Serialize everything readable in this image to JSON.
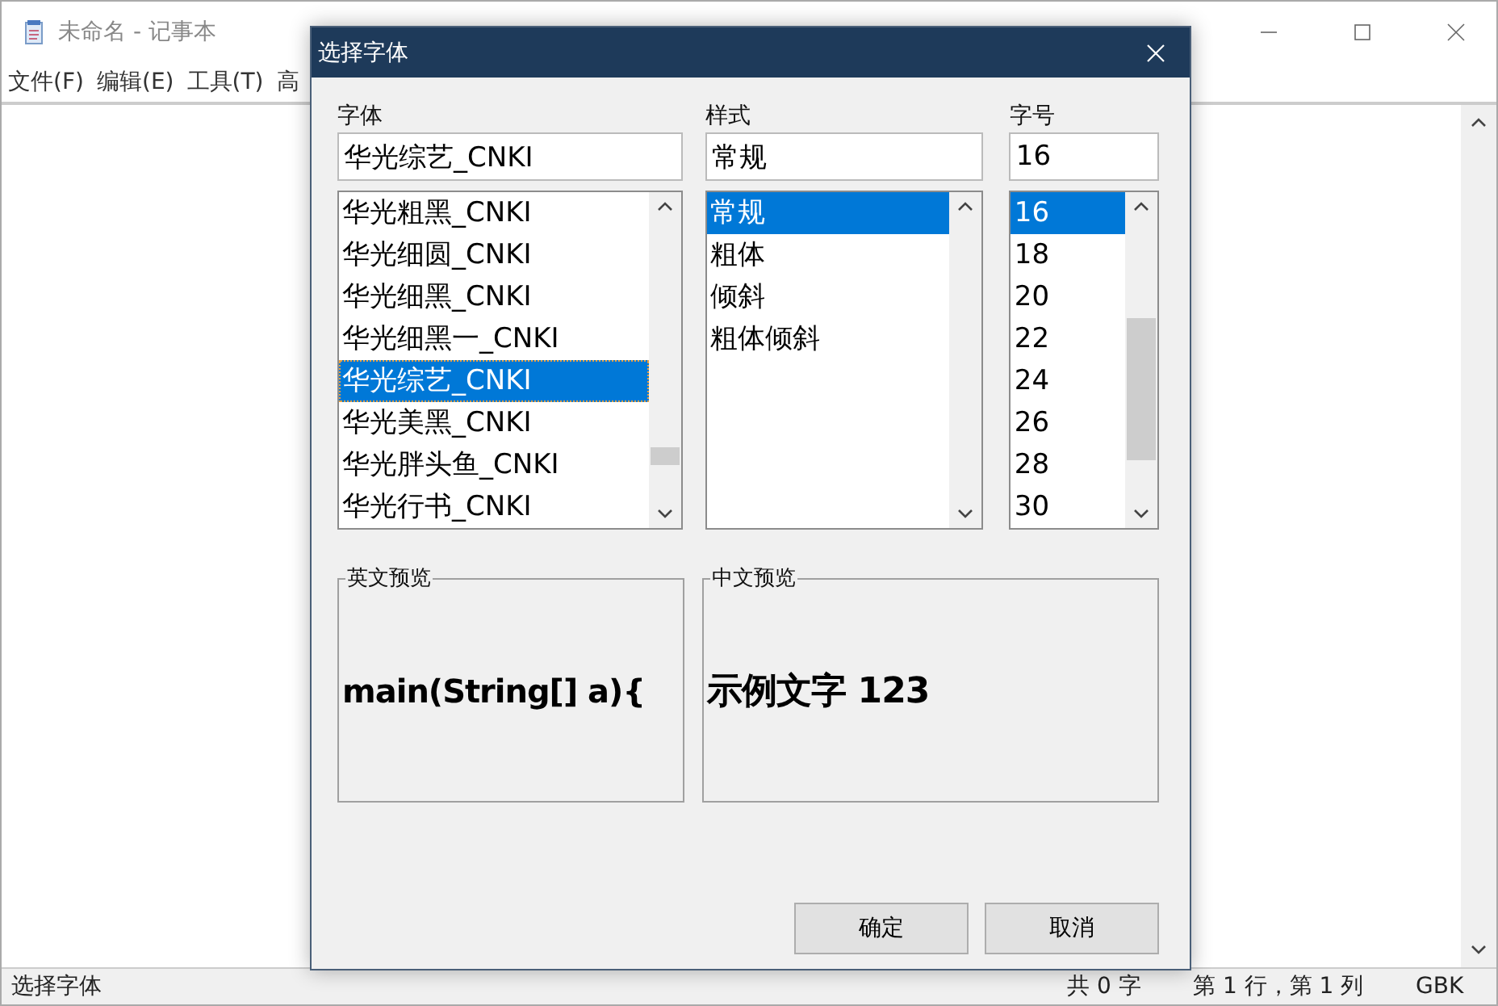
{
  "window": {
    "title": "未命名 - 记事本",
    "menu": [
      "文件(F)",
      "编辑(E)",
      "工具(T)",
      "高"
    ]
  },
  "dialog": {
    "title": "选择字体",
    "font": {
      "label": "字体",
      "value": "华光综艺_CNKI",
      "items": [
        {
          "text": "华光粗黑_CNKI",
          "selected": false
        },
        {
          "text": "华光细圆_CNKI",
          "selected": false
        },
        {
          "text": "华光细黑_CNKI",
          "selected": false
        },
        {
          "text": "华光细黑一_CNKI",
          "selected": false
        },
        {
          "text": "华光综艺_CNKI",
          "selected": true
        },
        {
          "text": "华光美黑_CNKI",
          "selected": false
        },
        {
          "text": "华光胖头鱼_CNKI",
          "selected": false
        },
        {
          "text": "华光行书_CNKI",
          "selected": false
        }
      ]
    },
    "style": {
      "label": "样式",
      "value": "常规",
      "items": [
        {
          "text": "常规",
          "selected": true
        },
        {
          "text": "粗体",
          "selected": false
        },
        {
          "text": "倾斜",
          "selected": false
        },
        {
          "text": "粗体倾斜",
          "selected": false
        }
      ]
    },
    "size": {
      "label": "字号",
      "value": "16",
      "items": [
        {
          "text": "16",
          "selected": true
        },
        {
          "text": "18",
          "selected": false
        },
        {
          "text": "20",
          "selected": false
        },
        {
          "text": "22",
          "selected": false
        },
        {
          "text": "24",
          "selected": false
        },
        {
          "text": "26",
          "selected": false
        },
        {
          "text": "28",
          "selected": false
        },
        {
          "text": "30",
          "selected": false
        }
      ]
    },
    "previews": [
      {
        "label": "英文预览",
        "sample": "main(String[] a){"
      },
      {
        "label": "中文预览",
        "sample": "示例文字 123"
      }
    ],
    "buttons": [
      "确定",
      "取消"
    ]
  },
  "status_bar": [
    "选择字体",
    "共 0 字",
    "第 1 行，第 1 列",
    "GBK"
  ]
}
